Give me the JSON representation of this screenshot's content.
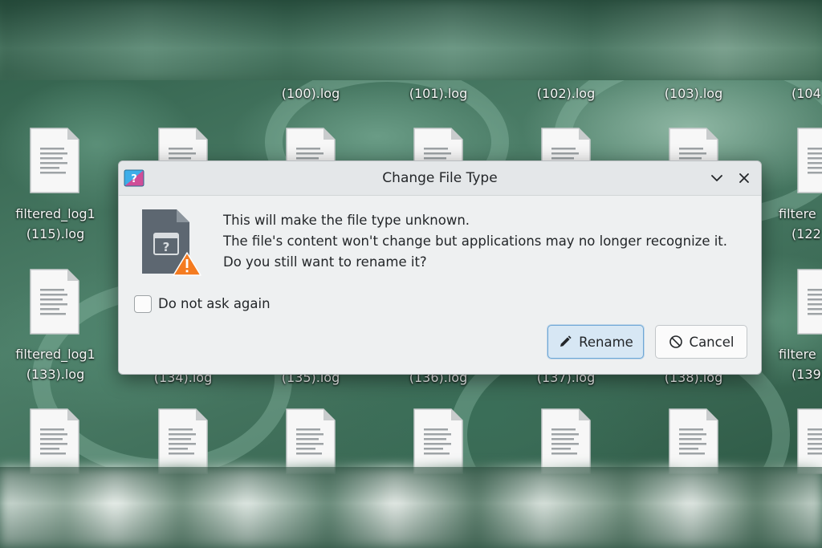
{
  "desktop": {
    "top_row_labels": [
      "(100).log",
      "(101).log",
      "(102).log",
      "(103).log",
      "(104"
    ],
    "middle_row_labels": [
      "(134).log",
      "(135).log",
      "(136).log",
      "(137).log",
      "(138).log"
    ],
    "left_files": [
      {
        "line1": "filtered_log1",
        "line2": "(115).log"
      },
      {
        "line1": "filtered_log1",
        "line2": "(133).log"
      }
    ],
    "right_files": [
      {
        "line1": "filtere",
        "line2": "(122"
      },
      {
        "line1": "filtere",
        "line2": "(139"
      }
    ]
  },
  "dialog": {
    "title": "Change File Type",
    "message_line1": "This will make the file type unknown.",
    "message_line2": "The file's content won't change but applications may no longer recognize it.",
    "message_line3": "Do you still want to rename it?",
    "checkbox_label": "Do not ask again",
    "checkbox_checked": false,
    "rename_label": "Rename",
    "cancel_label": "Cancel",
    "icons": {
      "app": "app-icon",
      "file": "unknown-file-warning-icon",
      "minimize": "chevron-down-icon",
      "close": "close-icon",
      "rename": "pencil-icon",
      "cancel": "cancel-circle-icon"
    },
    "colors": {
      "accent": "#6ea7d6",
      "warning": "#f47b20"
    }
  }
}
